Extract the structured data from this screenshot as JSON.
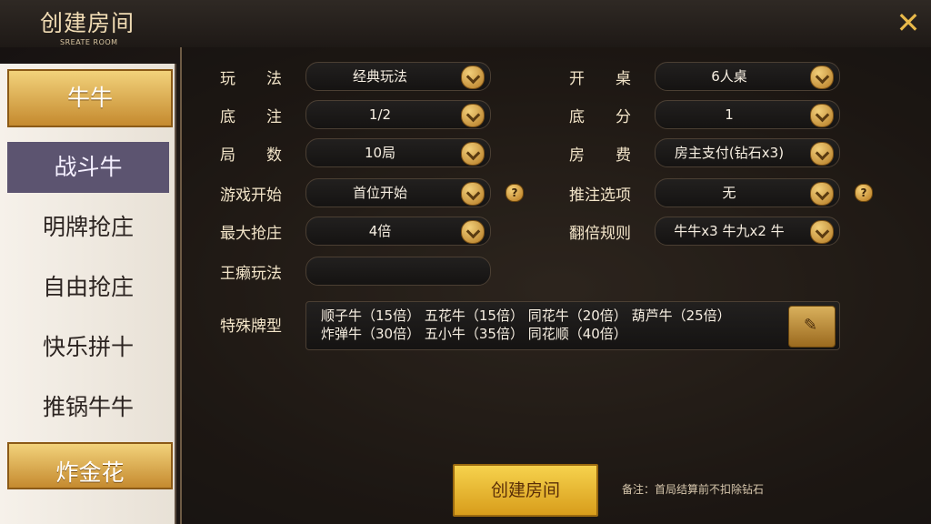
{
  "header": {
    "title": "创建房间",
    "subtitle": "SREATE ROOM",
    "close_label": "✕"
  },
  "sidebar": {
    "items": [
      {
        "label": "牛牛"
      },
      {
        "label": "战斗牛"
      },
      {
        "label": "明牌抢庄"
      },
      {
        "label": "自由抢庄"
      },
      {
        "label": "快乐拼十"
      },
      {
        "label": "推锅牛牛"
      },
      {
        "label": "炸金花"
      }
    ]
  },
  "form": {
    "wanfa": {
      "label": "玩　　法",
      "value": "经典玩法"
    },
    "kaizhuo": {
      "label": "开　　桌",
      "value": "6人桌"
    },
    "dizhu": {
      "label": "底　　注",
      "value": "1/2"
    },
    "difen": {
      "label": "底　　分",
      "value": "1"
    },
    "jushu": {
      "label": "局　　数",
      "value": "10局"
    },
    "fangfei": {
      "label": "房　　费",
      "value": "房主支付(钻石x3)"
    },
    "kaishi": {
      "label": "游戏开始",
      "value": "首位开始",
      "help": "?"
    },
    "tuizhu": {
      "label": "推注选项",
      "value": "无",
      "help": "?"
    },
    "qiangzhuang": {
      "label": "最大抢庄",
      "value": "4倍"
    },
    "fanbei": {
      "label": "翻倍规则",
      "value": "牛牛x3 牛九x2 牛"
    },
    "wanglai": {
      "label": "王癞玩法",
      "value": ""
    },
    "teshu": {
      "label": "特殊牌型",
      "line1": "顺子牛（15倍） 五花牛（15倍） 同花牛（20倍） 葫芦牛（25倍）",
      "line2": "炸弹牛（30倍） 五小牛（35倍） 同花顺（40倍）"
    }
  },
  "actions": {
    "create_label": "创建房间",
    "note": "备注：首局结算前不扣除钻石"
  }
}
